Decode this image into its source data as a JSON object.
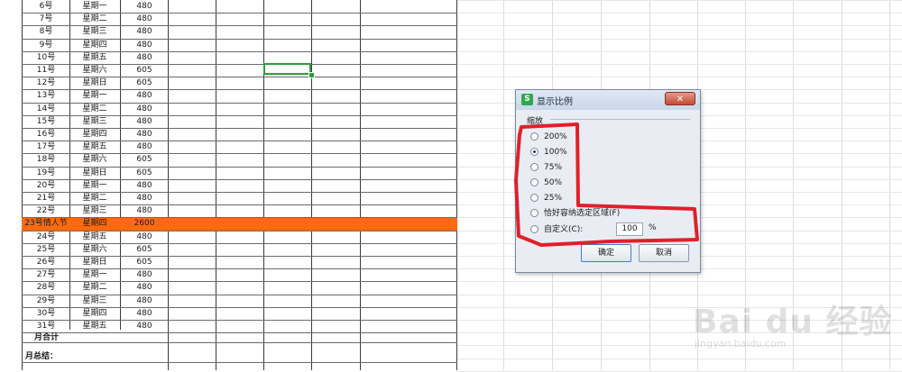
{
  "sheet": {
    "rows": [
      {
        "day": "6号",
        "weekday": "星期一",
        "amount": "480"
      },
      {
        "day": "7号",
        "weekday": "星期二",
        "amount": "480"
      },
      {
        "day": "8号",
        "weekday": "星期三",
        "amount": "480"
      },
      {
        "day": "9号",
        "weekday": "星期四",
        "amount": "480"
      },
      {
        "day": "10号",
        "weekday": "星期五",
        "amount": "480"
      },
      {
        "day": "11号",
        "weekday": "星期六",
        "amount": "605"
      },
      {
        "day": "12号",
        "weekday": "星期日",
        "amount": "605"
      },
      {
        "day": "13号",
        "weekday": "星期一",
        "amount": "480"
      },
      {
        "day": "14号",
        "weekday": "星期二",
        "amount": "480"
      },
      {
        "day": "15号",
        "weekday": "星期三",
        "amount": "480"
      },
      {
        "day": "16号",
        "weekday": "星期四",
        "amount": "480"
      },
      {
        "day": "17号",
        "weekday": "星期五",
        "amount": "480"
      },
      {
        "day": "18号",
        "weekday": "星期六",
        "amount": "605"
      },
      {
        "day": "19号",
        "weekday": "星期日",
        "amount": "605"
      },
      {
        "day": "20号",
        "weekday": "星期一",
        "amount": "480"
      },
      {
        "day": "21号",
        "weekday": "星期二",
        "amount": "480"
      },
      {
        "day": "22号",
        "weekday": "星期三",
        "amount": "480"
      },
      {
        "day": "23号情人节",
        "weekday": "星期四",
        "amount": "2600",
        "highlight": true
      },
      {
        "day": "24号",
        "weekday": "星期五",
        "amount": "480"
      },
      {
        "day": "25号",
        "weekday": "星期六",
        "amount": "605"
      },
      {
        "day": "26号",
        "weekday": "星期日",
        "amount": "605"
      },
      {
        "day": "27号",
        "weekday": "星期一",
        "amount": "480"
      },
      {
        "day": "28号",
        "weekday": "星期二",
        "amount": "480"
      },
      {
        "day": "29号",
        "weekday": "星期三",
        "amount": "480"
      },
      {
        "day": "30号",
        "weekday": "星期四",
        "amount": "480"
      },
      {
        "day": "31号",
        "weekday": "星期五",
        "amount": "480"
      }
    ],
    "month_total_label": "月合计",
    "month_summary_label": "月总结：",
    "highlight_color": "#ff6a0c"
  },
  "dialog": {
    "title": "显示比例",
    "close_label": "✕",
    "group_label": "缩放",
    "options": [
      {
        "label": "200%",
        "selected": false
      },
      {
        "label": "100%",
        "selected": true
      },
      {
        "label": "75%",
        "selected": false
      },
      {
        "label": "50%",
        "selected": false
      },
      {
        "label": "25%",
        "selected": false
      },
      {
        "label": "恰好容纳选定区域(F)",
        "selected": false
      },
      {
        "label": "自定义(C):",
        "selected": false
      }
    ],
    "custom_value": "100",
    "percent_sign": "%",
    "ok_label": "确定",
    "cancel_label": "取消",
    "icon_letter": "S",
    "icon_color": "#2fa84f",
    "annotation_color": "#e0202a"
  },
  "watermark": {
    "main": "Bai du 经验",
    "sub": "jingyan.baidu.com"
  }
}
